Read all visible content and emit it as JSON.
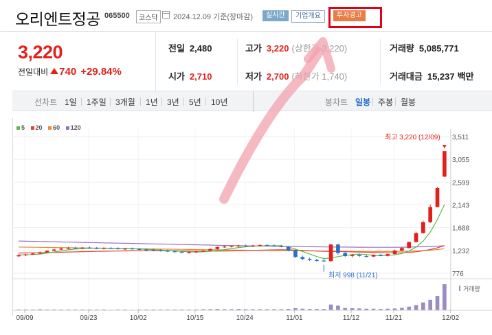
{
  "header": {
    "title": "오리엔트정공",
    "code": "065500",
    "market": "코스닥",
    "date": "2024.12.09",
    "basis": "기준(장마감)",
    "realtime_label": "실시간",
    "company_label": "기업개요",
    "warning_label": "투자경고"
  },
  "price": {
    "current": "3,220",
    "change_label": "전일대비",
    "change": "740",
    "change_pct": "+29.84%",
    "direction": "up"
  },
  "stats": {
    "prev_label": "전일",
    "prev_value": "2,480",
    "high_label": "고가",
    "high_value": "3,220",
    "upper_limit": "(상한가 3,220)",
    "volume_label": "거래량",
    "volume_value": "5,085,771",
    "open_label": "시가",
    "open_value": "2,710",
    "low_label": "저가",
    "low_value": "2,700",
    "lower_limit": "(하한가 1,740)",
    "amount_label": "거래대금",
    "amount_value": "15,237",
    "amount_unit": "백만"
  },
  "tabs": {
    "line_chart": "선차트",
    "periods": [
      "1일",
      "1주일",
      "3개월",
      "1년",
      "3년",
      "5년",
      "10년"
    ],
    "candle_chart": "봉차트",
    "candle_periods": [
      "일봉",
      "주봉",
      "월봉"
    ],
    "active_candle": "일봉"
  },
  "legend": [
    {
      "label": "5",
      "color": "#5db844"
    },
    {
      "label": "20",
      "color": "#d64541"
    },
    {
      "label": "60",
      "color": "#e98b3a"
    },
    {
      "label": "120",
      "color": "#9b6fc1"
    }
  ],
  "annotations": {
    "high": "최고 3,220 (12/09)",
    "low": "최저 998 (11/21)",
    "volume_label": "거래량"
  },
  "colors": {
    "up": "#e2211c",
    "down": "#2e6fc2",
    "warning": "#e87e46"
  },
  "chart_data": {
    "type": "candlestick",
    "y_ticks": [
      776,
      1232,
      1688,
      2143,
      2599,
      3055,
      3511
    ],
    "x_ticks": [
      "09/09",
      "09/23",
      "10/02",
      "10/15",
      "10/24",
      "11/01",
      "11/12",
      "11/21",
      "12/02"
    ],
    "ylim": [
      776,
      3511
    ],
    "legend_position": "top-left",
    "grid": true,
    "price_x": [
      0,
      1,
      2,
      3,
      4,
      5,
      6,
      7,
      8,
      9,
      10,
      11,
      12,
      13,
      14,
      15,
      16,
      17,
      18,
      19,
      20,
      21,
      22,
      23,
      24,
      25,
      26,
      27,
      28,
      29,
      30,
      31,
      32,
      33,
      34,
      35,
      36,
      37,
      38,
      39,
      40,
      41,
      42,
      43,
      44,
      45,
      46,
      47,
      48,
      49,
      50,
      51,
      52,
      53,
      54,
      55,
      56,
      57,
      58,
      59,
      60,
      61
    ],
    "ohlc": [
      [
        1115,
        1160,
        1100,
        1135
      ],
      [
        1135,
        1165,
        1120,
        1150
      ],
      [
        1150,
        1185,
        1140,
        1170
      ],
      [
        1170,
        1210,
        1160,
        1195
      ],
      [
        1195,
        1240,
        1185,
        1225
      ],
      [
        1225,
        1265,
        1215,
        1250
      ],
      [
        1250,
        1290,
        1240,
        1270
      ],
      [
        1270,
        1300,
        1255,
        1285
      ],
      [
        1285,
        1305,
        1260,
        1275
      ],
      [
        1275,
        1300,
        1255,
        1290
      ],
      [
        1290,
        1310,
        1265,
        1280
      ],
      [
        1280,
        1300,
        1255,
        1270
      ],
      [
        1270,
        1295,
        1250,
        1280
      ],
      [
        1280,
        1300,
        1260,
        1275
      ],
      [
        1275,
        1295,
        1250,
        1265
      ],
      [
        1265,
        1285,
        1240,
        1270
      ],
      [
        1270,
        1290,
        1250,
        1260
      ],
      [
        1260,
        1280,
        1235,
        1250
      ],
      [
        1250,
        1275,
        1225,
        1245
      ],
      [
        1245,
        1270,
        1220,
        1235
      ],
      [
        1235,
        1260,
        1210,
        1225
      ],
      [
        1225,
        1250,
        1200,
        1215
      ],
      [
        1215,
        1240,
        1190,
        1200
      ],
      [
        1200,
        1230,
        1180,
        1185
      ],
      [
        1185,
        1215,
        1170,
        1195
      ],
      [
        1195,
        1220,
        1180,
        1210
      ],
      [
        1210,
        1240,
        1195,
        1230
      ],
      [
        1230,
        1275,
        1215,
        1260
      ],
      [
        1260,
        1310,
        1250,
        1300
      ],
      [
        1300,
        1330,
        1285,
        1310
      ],
      [
        1310,
        1335,
        1290,
        1320
      ],
      [
        1320,
        1345,
        1300,
        1330
      ],
      [
        1330,
        1350,
        1305,
        1320
      ],
      [
        1320,
        1345,
        1300,
        1330
      ],
      [
        1330,
        1355,
        1310,
        1340
      ],
      [
        1340,
        1360,
        1315,
        1330
      ],
      [
        1330,
        1355,
        1305,
        1320
      ],
      [
        1320,
        1345,
        1295,
        1300
      ],
      [
        1300,
        1320,
        1215,
        1230
      ],
      [
        1230,
        1250,
        1080,
        1100
      ],
      [
        1100,
        1130,
        1040,
        1060
      ],
      [
        1060,
        1090,
        1020,
        1040
      ],
      [
        1040,
        1070,
        1005,
        1030
      ],
      [
        1030,
        1060,
        998,
        1020
      ],
      [
        1020,
        1370,
        1000,
        1350
      ],
      [
        1350,
        1370,
        1150,
        1180
      ],
      [
        1180,
        1210,
        1100,
        1120
      ],
      [
        1120,
        1160,
        1090,
        1140
      ],
      [
        1140,
        1170,
        1100,
        1120
      ],
      [
        1120,
        1150,
        1090,
        1110
      ],
      [
        1110,
        1150,
        1100,
        1145
      ],
      [
        1145,
        1160,
        1115,
        1125
      ],
      [
        1125,
        1170,
        1110,
        1160
      ],
      [
        1160,
        1250,
        1150,
        1230
      ],
      [
        1230,
        1300,
        1220,
        1280
      ],
      [
        1280,
        1410,
        1270,
        1400
      ],
      [
        1400,
        1600,
        1390,
        1580
      ],
      [
        1580,
        1830,
        1570,
        1800
      ],
      [
        1800,
        2150,
        1780,
        2100
      ],
      [
        2100,
        2500,
        2100,
        2480
      ],
      [
        2710,
        3220,
        2700,
        3220
      ]
    ],
    "volume": [
      1,
      1,
      1,
      1,
      1,
      1,
      1,
      1,
      1,
      1,
      1,
      1,
      1,
      1,
      1,
      1,
      1,
      1,
      1,
      1,
      1,
      1,
      1,
      1,
      1,
      1,
      1,
      1,
      1,
      1,
      1,
      1,
      1,
      1,
      1,
      1,
      1,
      1,
      1,
      1,
      1,
      1,
      1,
      1,
      1,
      1,
      1,
      1,
      1,
      1,
      1,
      1,
      1,
      1,
      1,
      1,
      1,
      1,
      1,
      1,
      1
    ],
    "volume_rel": [
      0.03,
      0.03,
      0.03,
      0.04,
      0.03,
      0.03,
      0.03,
      0.03,
      0.03,
      0.03,
      0.03,
      0.03,
      0.03,
      0.02,
      0.03,
      0.03,
      0.02,
      0.03,
      0.03,
      0.03,
      0.03,
      0.03,
      0.03,
      0.03,
      0.03,
      0.03,
      0.04,
      0.04,
      0.05,
      0.04,
      0.04,
      0.05,
      0.04,
      0.04,
      0.04,
      0.04,
      0.04,
      0.04,
      0.05,
      0.08,
      0.06,
      0.05,
      0.05,
      0.05,
      0.22,
      0.18,
      0.09,
      0.08,
      0.07,
      0.06,
      0.06,
      0.05,
      0.06,
      0.07,
      0.09,
      0.14,
      0.2,
      0.3,
      0.4,
      0.55,
      1.0
    ],
    "ma5": [
      1140,
      1145,
      1150,
      1160,
      1180,
      1200,
      1225,
      1245,
      1260,
      1270,
      1275,
      1278,
      1278,
      1276,
      1272,
      1270,
      1266,
      1262,
      1255,
      1248,
      1240,
      1232,
      1222,
      1212,
      1205,
      1200,
      1205,
      1215,
      1230,
      1250,
      1270,
      1290,
      1305,
      1315,
      1322,
      1326,
      1328,
      1326,
      1300,
      1260,
      1210,
      1160,
      1110,
      1070,
      1080,
      1110,
      1130,
      1150,
      1160,
      1150,
      1135,
      1128,
      1130,
      1145,
      1170,
      1220,
      1300,
      1420,
      1600,
      1850,
      2150
    ],
    "ma20": [
      1180,
      1182,
      1184,
      1186,
      1189,
      1192,
      1196,
      1200,
      1204,
      1207,
      1210,
      1213,
      1216,
      1218,
      1220,
      1222,
      1224,
      1225,
      1226,
      1226,
      1226,
      1226,
      1225,
      1223,
      1221,
      1219,
      1218,
      1218,
      1219,
      1221,
      1223,
      1226,
      1229,
      1232,
      1236,
      1240,
      1243,
      1245,
      1243,
      1238,
      1232,
      1226,
      1220,
      1214,
      1212,
      1210,
      1207,
      1204,
      1200,
      1196,
      1192,
      1188,
      1185,
      1184,
      1186,
      1192,
      1205,
      1225,
      1250,
      1285,
      1330
    ],
    "ma60": [
      1300,
      1298,
      1296,
      1294,
      1292,
      1290,
      1288,
      1286,
      1284,
      1282,
      1280,
      1278,
      1276,
      1274,
      1272,
      1270,
      1268,
      1266,
      1264,
      1262,
      1260,
      1258,
      1256,
      1254,
      1252,
      1250,
      1248,
      1246,
      1244,
      1242,
      1240,
      1238,
      1236,
      1234,
      1232,
      1231,
      1230,
      1229,
      1228,
      1226,
      1224,
      1222,
      1220,
      1218,
      1216,
      1215,
      1214,
      1213,
      1212,
      1211,
      1210,
      1210,
      1210,
      1211,
      1213,
      1216,
      1221,
      1228,
      1238,
      1250,
      1266
    ],
    "ma120": [
      1420,
      1417,
      1414,
      1411,
      1408,
      1405,
      1402,
      1399,
      1396,
      1393,
      1390,
      1387,
      1384,
      1381,
      1378,
      1375,
      1372,
      1369,
      1366,
      1363,
      1360,
      1357,
      1354,
      1351,
      1348,
      1345,
      1342,
      1339,
      1336,
      1333,
      1330,
      1327,
      1325,
      1323,
      1321,
      1319,
      1317,
      1315,
      1313,
      1311,
      1309,
      1307,
      1305,
      1303,
      1301,
      1300,
      1299,
      1298,
      1297,
      1296,
      1295,
      1295,
      1295,
      1296,
      1297,
      1299,
      1302,
      1306,
      1311,
      1318,
      1326
    ]
  }
}
